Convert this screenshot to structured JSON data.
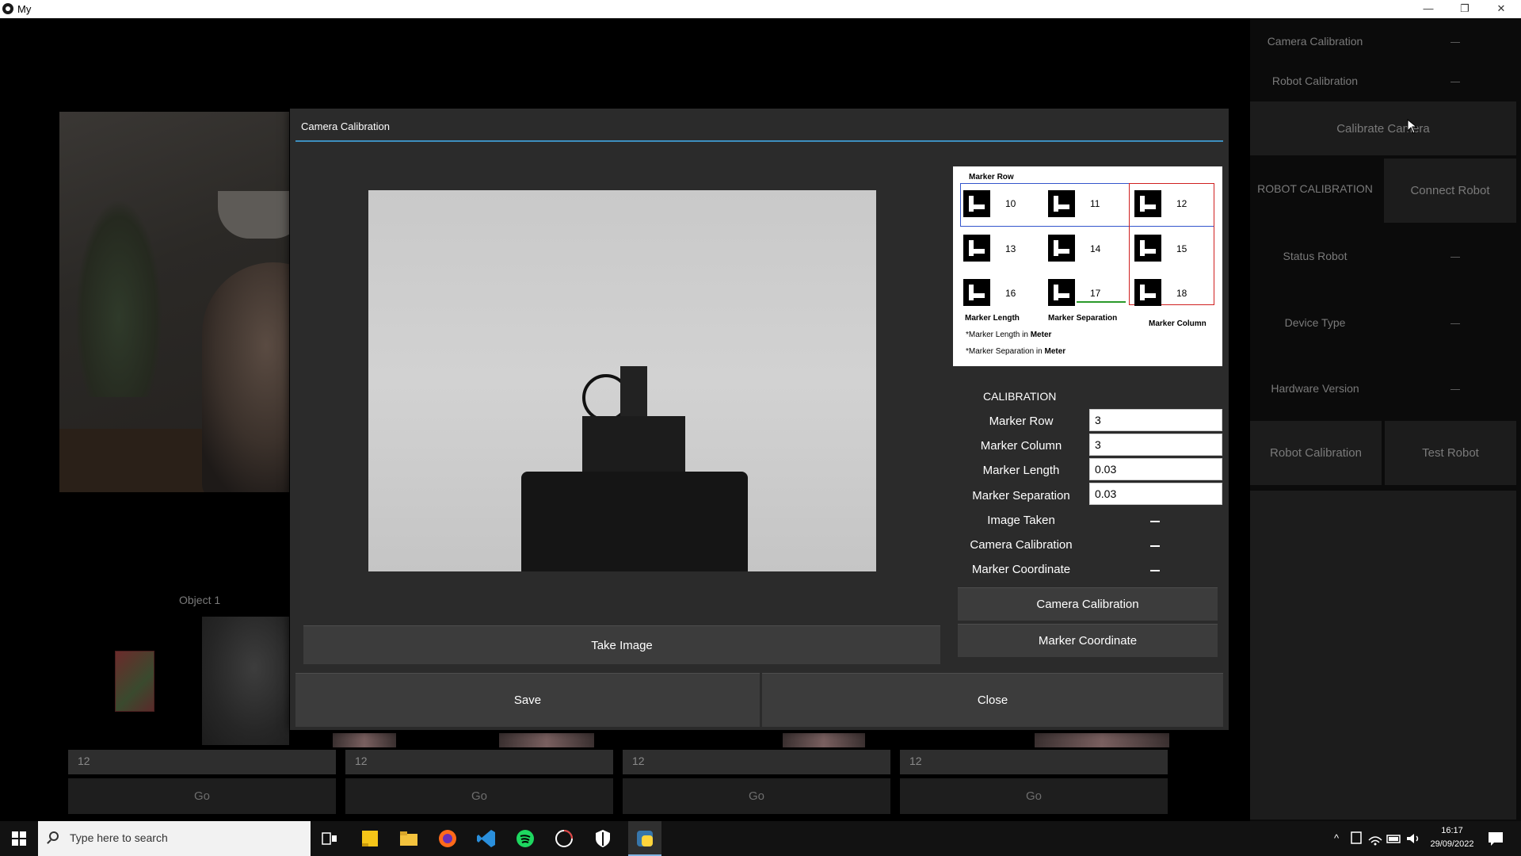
{
  "window": {
    "title": "My",
    "minimize": "—",
    "restore": "❐",
    "close": "✕"
  },
  "right_panel": {
    "camera_calibration_label": "Camera Calibration",
    "robot_calibration_label": "Robot Calibration",
    "calibrate_camera_button": "Calibrate Camera",
    "robot_calibration_heading": "ROBOT CALIBRATION",
    "connect_robot_button": "Connect Robot",
    "status_robot_label": "Status Robot",
    "device_type_label": "Device Type",
    "hardware_version_label": "Hardware Version",
    "robot_calibration_button": "Robot Calibration",
    "test_robot_button": "Test Robot"
  },
  "background": {
    "object_label": "Object 1",
    "slots": [
      {
        "value": "12",
        "go": "Go"
      },
      {
        "value": "12",
        "go": "Go"
      },
      {
        "value": "12",
        "go": "Go"
      },
      {
        "value": "12",
        "go": "Go"
      }
    ]
  },
  "dialog": {
    "title": "Camera Calibration",
    "reference_card": {
      "header": "Marker Row",
      "markers": [
        "10",
        "11",
        "12",
        "13",
        "14",
        "15",
        "16",
        "17",
        "18"
      ],
      "caption_length": "Marker Length",
      "caption_separation": "Marker Separation",
      "caption_column": "Marker Column",
      "note_length_prefix": "*Marker Length in ",
      "note_length_unit": "Meter",
      "note_sep_prefix": "*Marker Separation in ",
      "note_sep_unit": "Meter"
    },
    "calibration_heading": "CALIBRATION",
    "fields": {
      "marker_row_label": "Marker Row",
      "marker_row_value": "3",
      "marker_column_label": "Marker Column",
      "marker_column_value": "3",
      "marker_length_label": "Marker Length",
      "marker_length_value": "0.03",
      "marker_separation_label": "Marker Separation",
      "marker_separation_value": "0.03"
    },
    "status": {
      "image_taken_label": "Image Taken",
      "camera_calibration_label": "Camera Calibration",
      "marker_coordinate_label": "Marker Coordinate"
    },
    "buttons": {
      "camera_calibration": "Camera Calibration",
      "marker_coordinate": "Marker Coordinate",
      "take_image": "Take Image",
      "save": "Save",
      "close": "Close"
    }
  },
  "taskbar": {
    "search_placeholder": "Type here to search",
    "time": "16:17",
    "date": "29/09/2022"
  }
}
